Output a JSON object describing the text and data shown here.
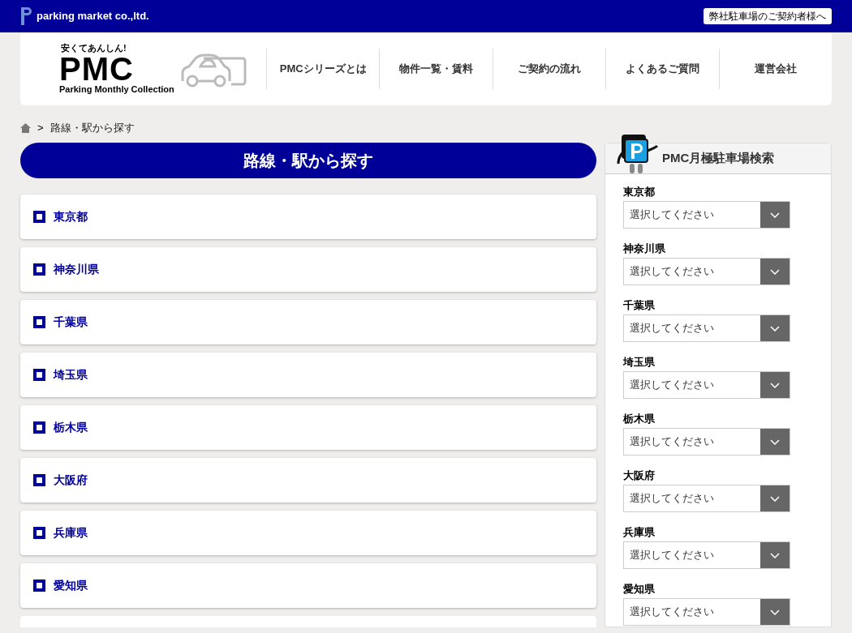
{
  "top_bar": {
    "company": "parking market co.,ltd.",
    "link": "弊社駐車場のご契約者様へ"
  },
  "logo": {
    "tagline": "安くてあんしん!",
    "name": "PMC",
    "subtitle": "Parking Monthly Collection"
  },
  "nav": [
    "PMCシリーズとは",
    "物件一覧・賃料",
    "ご契約の流れ",
    "よくあるご質問",
    "運営会社"
  ],
  "breadcrumb": {
    "separator": ">",
    "current": "路線・駅から探す"
  },
  "page_title": "路線・駅から探す",
  "prefectures": [
    "東京都",
    "神奈川県",
    "千葉県",
    "埼玉県",
    "栃木県",
    "大阪府",
    "兵庫県",
    "愛知県"
  ],
  "sidebar": {
    "title": "PMC月極駐車場検索",
    "selects": [
      {
        "label": "東京都",
        "value": "選択してください"
      },
      {
        "label": "神奈川県",
        "value": "選択してください"
      },
      {
        "label": "千葉県",
        "value": "選択してください"
      },
      {
        "label": "埼玉県",
        "value": "選択してください"
      },
      {
        "label": "栃木県",
        "value": "選択してください"
      },
      {
        "label": "大阪府",
        "value": "選択してください"
      },
      {
        "label": "兵庫県",
        "value": "選択してください"
      },
      {
        "label": "愛知県",
        "value": "選択してください"
      }
    ]
  }
}
